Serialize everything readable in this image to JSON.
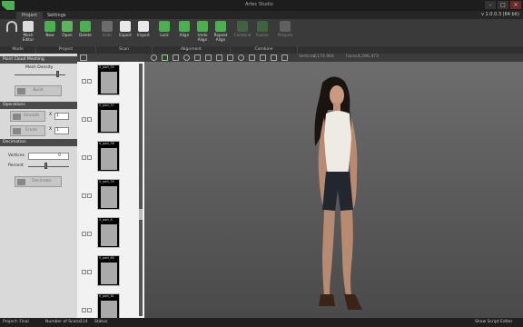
{
  "window": {
    "title": "Artec Studio",
    "minimize": "–",
    "maximize": "□",
    "close": "×"
  },
  "menu": {
    "tabs": [
      "Project",
      "Settings"
    ],
    "version": "v 1.0.0.3 (64 bit)"
  },
  "ribbon": {
    "buttons": [
      {
        "label": "Mesh Editor"
      },
      {
        "label": "New"
      },
      {
        "label": "Open"
      },
      {
        "label": "Delete"
      },
      {
        "label": "Scan"
      },
      {
        "label": "Export"
      },
      {
        "label": "Import"
      },
      {
        "label": "Lock"
      },
      {
        "label": "Align"
      },
      {
        "label": "Undo Align"
      },
      {
        "label": "Repeat Align"
      },
      {
        "label": "Combine"
      },
      {
        "label": "Fusion"
      },
      {
        "label": "Prepare"
      }
    ],
    "sections": [
      "Mode",
      "Project",
      "Scan",
      "Alignment",
      "Combine"
    ]
  },
  "left_panel": {
    "point_cloud_header": "Point Cloud Meshing",
    "mesh_density_label": "Mesh Density",
    "mesh_density_value": 0.85,
    "build_label": "Build",
    "operations_header": "Operations",
    "smooth_label": "Smooth",
    "smooth_x": "X",
    "smooth_value": "1",
    "erode_label": "Erode",
    "erode_x": "X",
    "erode_value": "1",
    "decimation_header": "Decimation",
    "vertices_label": "Vertices",
    "vertices_value": "0",
    "percent_label": "Percent",
    "percent_value": 0.45,
    "decimate_label": "Decimate"
  },
  "thumbnails": [
    {
      "name": "5_part_55"
    },
    {
      "name": "5_part_57"
    },
    {
      "name": "5_part_58"
    },
    {
      "name": "5_part_59"
    },
    {
      "name": "5_part_6"
    },
    {
      "name": "5_part_60"
    },
    {
      "name": "5_part_61"
    }
  ],
  "viewport": {
    "vertices_label": "Vertices:",
    "vertices_value": "2,174,964",
    "faces_label": "Faces:",
    "faces_value": "4,296,473"
  },
  "status": {
    "project": "Project: Final",
    "scans_label": "Number of Scans:",
    "scans_value": "114",
    "status_label": "Status",
    "show_editor": "Show Script Editor"
  },
  "colors": {
    "accent": "#4caf50",
    "panel": "#d9d9d9",
    "ribbon": "#3a3a3a"
  }
}
